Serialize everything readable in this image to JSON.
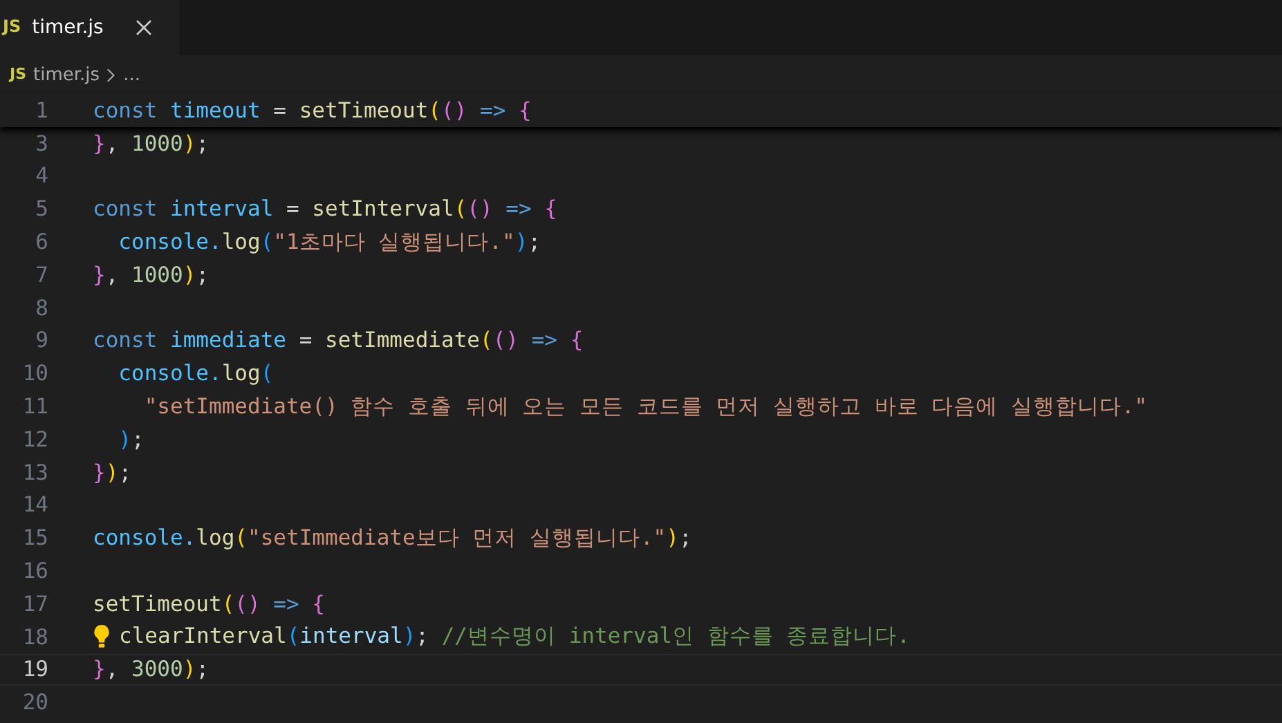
{
  "tabs": [
    {
      "icon_text": "JS",
      "label": "timer.js",
      "selected": true
    }
  ],
  "breadcrumb": {
    "icon_text": "JS",
    "file": "timer.js",
    "rest": "..."
  },
  "sticky_line": {
    "number": "1",
    "tokens": [
      {
        "text": "const ",
        "kind": "keyword"
      },
      {
        "text": "timeout",
        "kind": "const"
      },
      {
        "text": " = ",
        "kind": "plain"
      },
      {
        "text": "setTimeout",
        "kind": "fn"
      },
      {
        "text": "(",
        "kind": "b1"
      },
      {
        "text": "()",
        "kind": "b2"
      },
      {
        "text": " => ",
        "kind": "keyword"
      },
      {
        "text": "{",
        "kind": "b2"
      }
    ]
  },
  "lines": [
    {
      "number": "3",
      "current": false,
      "lightbulb": false,
      "tokens": [
        {
          "text": "}",
          "kind": "b2"
        },
        {
          "text": ", ",
          "kind": "plain"
        },
        {
          "text": "1000",
          "kind": "num"
        },
        {
          "text": ")",
          "kind": "b1"
        },
        {
          "text": ";",
          "kind": "plain"
        }
      ]
    },
    {
      "number": "4",
      "current": false,
      "lightbulb": false
    },
    {
      "number": "5",
      "current": false,
      "lightbulb": false,
      "tokens": [
        {
          "text": "const ",
          "kind": "keyword"
        },
        {
          "text": "interval",
          "kind": "const"
        },
        {
          "text": " = ",
          "kind": "plain"
        },
        {
          "text": "setInterval",
          "kind": "fn"
        },
        {
          "text": "(",
          "kind": "b1"
        },
        {
          "text": "()",
          "kind": "b2"
        },
        {
          "text": " => ",
          "kind": "keyword"
        },
        {
          "text": "{",
          "kind": "b2"
        }
      ]
    },
    {
      "number": "6",
      "current": false,
      "lightbulb": false,
      "tokens": [
        {
          "text": "  console.",
          "kind": "const"
        },
        {
          "text": "log",
          "kind": "fn"
        },
        {
          "text": "(",
          "kind": "b3"
        },
        {
          "text": "\"1초마다 실행됩니다.\"",
          "kind": "str"
        },
        {
          "text": ")",
          "kind": "b3"
        },
        {
          "text": ";",
          "kind": "plain"
        }
      ]
    },
    {
      "number": "7",
      "current": false,
      "lightbulb": false,
      "tokens": [
        {
          "text": "}",
          "kind": "b2"
        },
        {
          "text": ", ",
          "kind": "plain"
        },
        {
          "text": "1000",
          "kind": "num"
        },
        {
          "text": ")",
          "kind": "b1"
        },
        {
          "text": ";",
          "kind": "plain"
        }
      ]
    },
    {
      "number": "8",
      "current": false,
      "lightbulb": false
    },
    {
      "number": "9",
      "current": false,
      "lightbulb": false,
      "tokens": [
        {
          "text": "const ",
          "kind": "keyword"
        },
        {
          "text": "immediate",
          "kind": "const"
        },
        {
          "text": " = ",
          "kind": "plain"
        },
        {
          "text": "setImmediate",
          "kind": "fn"
        },
        {
          "text": "(",
          "kind": "b1"
        },
        {
          "text": "()",
          "kind": "b2"
        },
        {
          "text": " => ",
          "kind": "keyword"
        },
        {
          "text": "{",
          "kind": "b2"
        }
      ]
    },
    {
      "number": "10",
      "current": false,
      "lightbulb": false,
      "tokens": [
        {
          "text": "  console.",
          "kind": "const"
        },
        {
          "text": "log",
          "kind": "fn"
        },
        {
          "text": "(",
          "kind": "b3"
        }
      ]
    },
    {
      "number": "11",
      "current": false,
      "lightbulb": false,
      "tokens": [
        {
          "text": "    \"setImmediate() 함수 호출 뒤에 오는 모든 코드를 먼저 실행하고 바로 다음에 실행합니다.\"",
          "kind": "str"
        }
      ]
    },
    {
      "number": "12",
      "current": false,
      "lightbulb": false,
      "tokens": [
        {
          "text": "  )",
          "kind": "b3"
        },
        {
          "text": ";",
          "kind": "plain"
        }
      ]
    },
    {
      "number": "13",
      "current": false,
      "lightbulb": false,
      "tokens": [
        {
          "text": "}",
          "kind": "b2"
        },
        {
          "text": ")",
          "kind": "b1"
        },
        {
          "text": ";",
          "kind": "plain"
        }
      ]
    },
    {
      "number": "14",
      "current": false,
      "lightbulb": false
    },
    {
      "number": "15",
      "current": false,
      "lightbulb": false,
      "tokens": [
        {
          "text": "console.",
          "kind": "const"
        },
        {
          "text": "log",
          "kind": "fn"
        },
        {
          "text": "(",
          "kind": "b1"
        },
        {
          "text": "\"setImmediate보다 먼저 실행됩니다.\"",
          "kind": "str"
        },
        {
          "text": ")",
          "kind": "b1"
        },
        {
          "text": ";",
          "kind": "plain"
        }
      ]
    },
    {
      "number": "16",
      "current": false,
      "lightbulb": false
    },
    {
      "number": "17",
      "current": false,
      "lightbulb": false,
      "tokens": [
        {
          "text": "setTimeout",
          "kind": "fn"
        },
        {
          "text": "(",
          "kind": "b1"
        },
        {
          "text": "()",
          "kind": "b2"
        },
        {
          "text": " => ",
          "kind": "keyword"
        },
        {
          "text": "{",
          "kind": "b2"
        }
      ]
    },
    {
      "number": "18",
      "current": false,
      "lightbulb": true,
      "tokens": [
        {
          "text": "clearInterval",
          "kind": "fn"
        },
        {
          "text": "(",
          "kind": "b3"
        },
        {
          "text": "interval",
          "kind": "var"
        },
        {
          "text": ")",
          "kind": "b3"
        },
        {
          "text": "; ",
          "kind": "plain"
        },
        {
          "text": "//변수명이 interval인 함수를 종료합니다.",
          "kind": "comment"
        }
      ]
    },
    {
      "number": "19",
      "current": true,
      "lightbulb": false,
      "tokens": [
        {
          "text": "}",
          "kind": "b2"
        },
        {
          "text": ", ",
          "kind": "plain"
        },
        {
          "text": "3000",
          "kind": "num"
        },
        {
          "text": ")",
          "kind": "b1"
        },
        {
          "text": ";",
          "kind": "plain"
        }
      ]
    },
    {
      "number": "20",
      "current": false,
      "lightbulb": false
    }
  ]
}
